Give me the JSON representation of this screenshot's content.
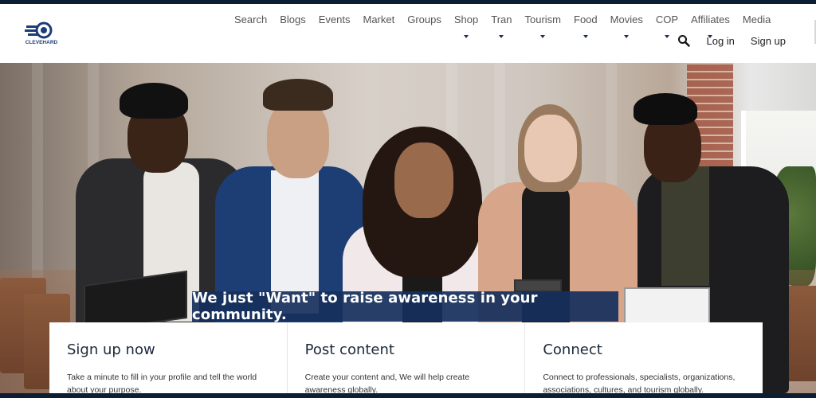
{
  "brand": {
    "logo_text": "CLEVEHARD"
  },
  "nav": {
    "items": [
      {
        "label": "Search",
        "dropdown": false
      },
      {
        "label": "Blogs",
        "dropdown": false
      },
      {
        "label": "Events",
        "dropdown": false
      },
      {
        "label": "Market",
        "dropdown": false
      },
      {
        "label": "Groups",
        "dropdown": false
      },
      {
        "label": "Shop",
        "dropdown": true
      },
      {
        "label": "Tran",
        "dropdown": true
      },
      {
        "label": "Tourism",
        "dropdown": true
      },
      {
        "label": "Food",
        "dropdown": true
      },
      {
        "label": "Movies",
        "dropdown": true
      },
      {
        "label": "COP",
        "dropdown": true
      },
      {
        "label": "Affiliates",
        "dropdown": true
      },
      {
        "label": "Media",
        "dropdown": false
      }
    ],
    "login_label": "Log in",
    "signup_label": "Sign up"
  },
  "hero": {
    "tagline": "We just \"Want\" to raise awareness in your community."
  },
  "cards": [
    {
      "title": "Sign up now",
      "text": "Take a minute to fill in your profile and tell the world about your purpose."
    },
    {
      "title": "Post content",
      "text": "Create your content and, We will help create awareness globally."
    },
    {
      "title": "Connect",
      "text": "Connect to professionals, specialists, organizations, associations, cultures, and tourism globally."
    }
  ],
  "colors": {
    "accent": "#16305c",
    "nav_text": "#555555",
    "background": "#ffffff"
  },
  "icons": {
    "search": "search-icon",
    "dropdown": "caret-down-icon"
  }
}
